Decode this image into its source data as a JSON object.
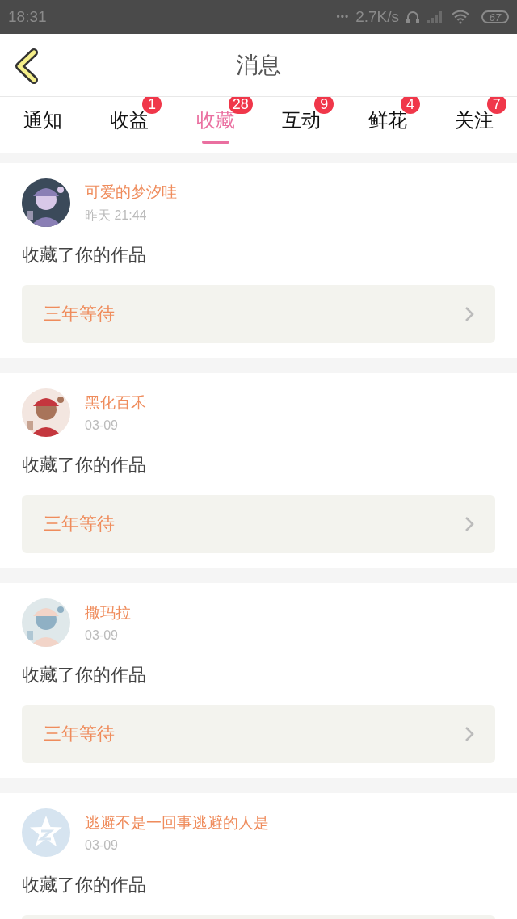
{
  "status_bar": {
    "time": "18:31",
    "dots": "•••",
    "speed": "2.7K/s",
    "battery": "67"
  },
  "header": {
    "title": "消息"
  },
  "tabs": [
    {
      "label": "通知",
      "selected": false
    },
    {
      "label": "收益",
      "selected": false,
      "badge": "1"
    },
    {
      "label": "收藏",
      "selected": true,
      "badge": "28"
    },
    {
      "label": "互动",
      "selected": false,
      "badge": "9"
    },
    {
      "label": "鲜花",
      "selected": false,
      "badge": "4"
    },
    {
      "label": "关注",
      "selected": false,
      "badge": "7"
    }
  ],
  "messages": [
    {
      "user": "可爱的梦汐哇",
      "time": "昨天 21:44",
      "action": "收藏了你的作品",
      "work": "三年等待"
    },
    {
      "user": "黑化百禾",
      "time": "03-09",
      "action": "收藏了你的作品",
      "work": "三年等待"
    },
    {
      "user": "撒玛拉",
      "time": "03-09",
      "action": "收藏了你的作品",
      "work": "三年等待"
    },
    {
      "avatar": {
        "kind": "default"
      },
      "user": "逃避不是一回事逃避的人是",
      "time": "03-09",
      "action": "收藏了你的作品"
    }
  ]
}
